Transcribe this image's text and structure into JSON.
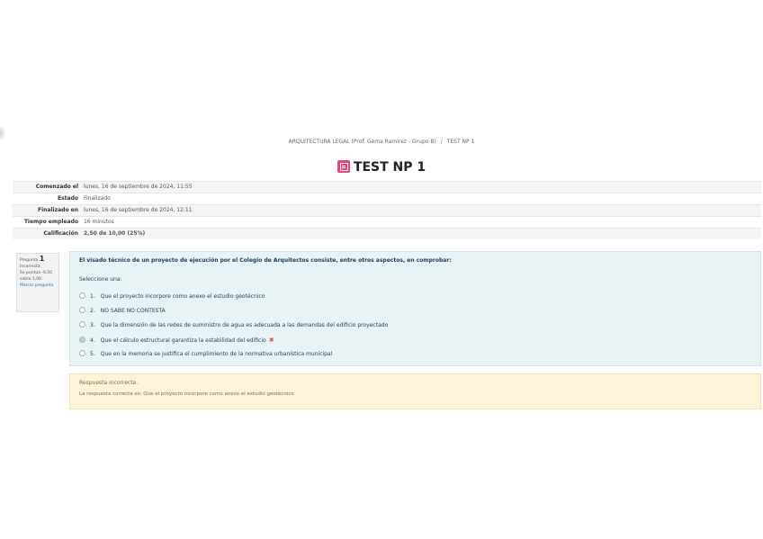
{
  "breadcrumb": {
    "course": "ARQUITECTURA LEGAL (Prof. Gema Ramírez - Grupo B)",
    "separator": "/",
    "current": "TEST NP 1"
  },
  "page_title": "TEST NP 1",
  "summary": [
    {
      "label": "Comenzado el",
      "value": "lunes, 16 de septiembre de 2024, 11:55"
    },
    {
      "label": "Estado",
      "value": "Finalizado"
    },
    {
      "label": "Finalizado en",
      "value": "lunes, 16 de septiembre de 2024, 12:11"
    },
    {
      "label": "Tiempo empleado",
      "value": "16 minutos"
    },
    {
      "label": "Calificación",
      "value": "2,50 de 10,00 (25%)"
    }
  ],
  "question_info": {
    "label": "Pregunta",
    "number": "1",
    "state": "Incorrecta",
    "score": "Se puntúa -0,50 sobre 1,00",
    "flag": "Marcar pregunta"
  },
  "question": {
    "text": "El visado técnico de un proyecto de ejecución por el Colegio de Arquitectos consiste, entre otros aspectos, en comprobar:",
    "prompt": "Seleccione una:",
    "answers": [
      {
        "num": "1.",
        "text": "Que el proyecto incorpore como anexo el estudio geotécnico"
      },
      {
        "num": "2.",
        "text": "NO SABE NO CONTESTA"
      },
      {
        "num": "3.",
        "text": "Que la dimensión de las redes de suministro de agua es adecuada a las demandas del edificio proyectado"
      },
      {
        "num": "4.",
        "text": "Que el cálculo estructural garantiza la estabilidad del edificio"
      },
      {
        "num": "5.",
        "text": "Que en la memoria se justifica el cumplimiento de la normativa urbanística municipal"
      }
    ],
    "selected_index": 3
  },
  "feedback": {
    "state": "Respuesta incorrecta.",
    "correct_answer": "La respuesta correcta es: Que el proyecto incorpore como anexo el estudio geotécnico"
  },
  "colors": {
    "question_bg": "#e7f3f5",
    "feedback_bg": "#fcf3d9",
    "quiz_icon": "#e8447e",
    "wrong": "#d9534f"
  }
}
